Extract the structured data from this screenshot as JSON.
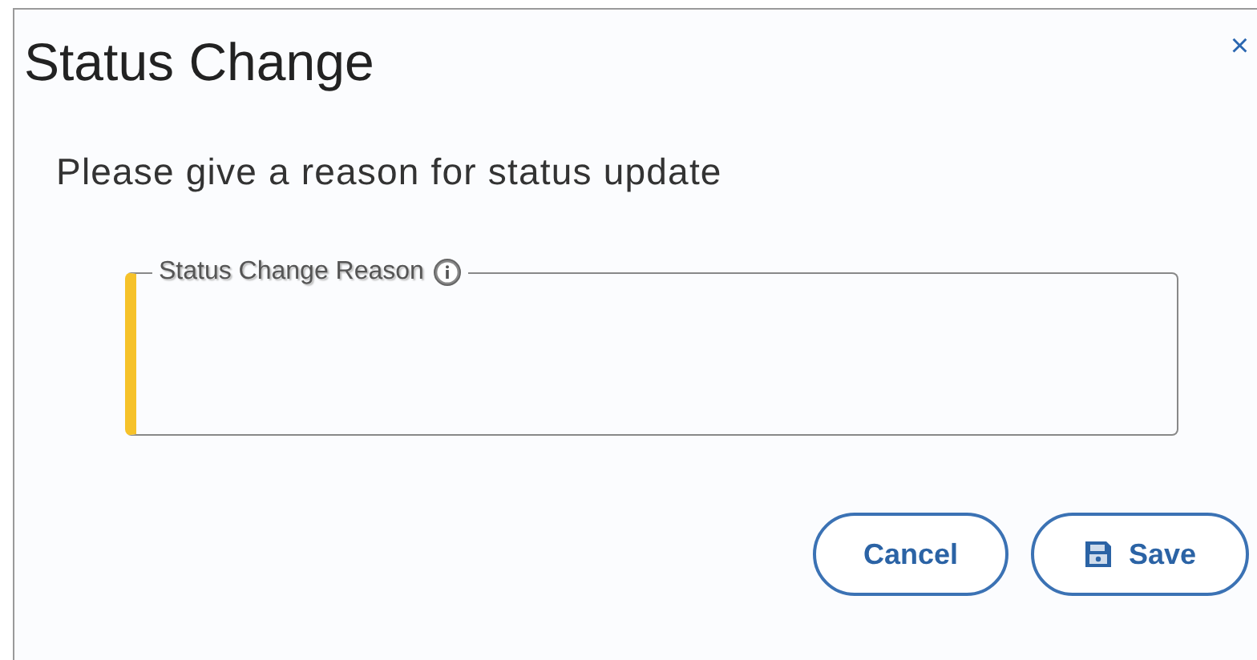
{
  "dialog": {
    "title": "Status Change",
    "close": "×"
  },
  "message": "Please give a reason for status update",
  "field": {
    "label": "Status Change Reason",
    "required": true
  },
  "buttons": [
    {
      "label": "Cancel",
      "kind": "plain"
    },
    {
      "label": "Save",
      "kind": "save"
    }
  ]
}
